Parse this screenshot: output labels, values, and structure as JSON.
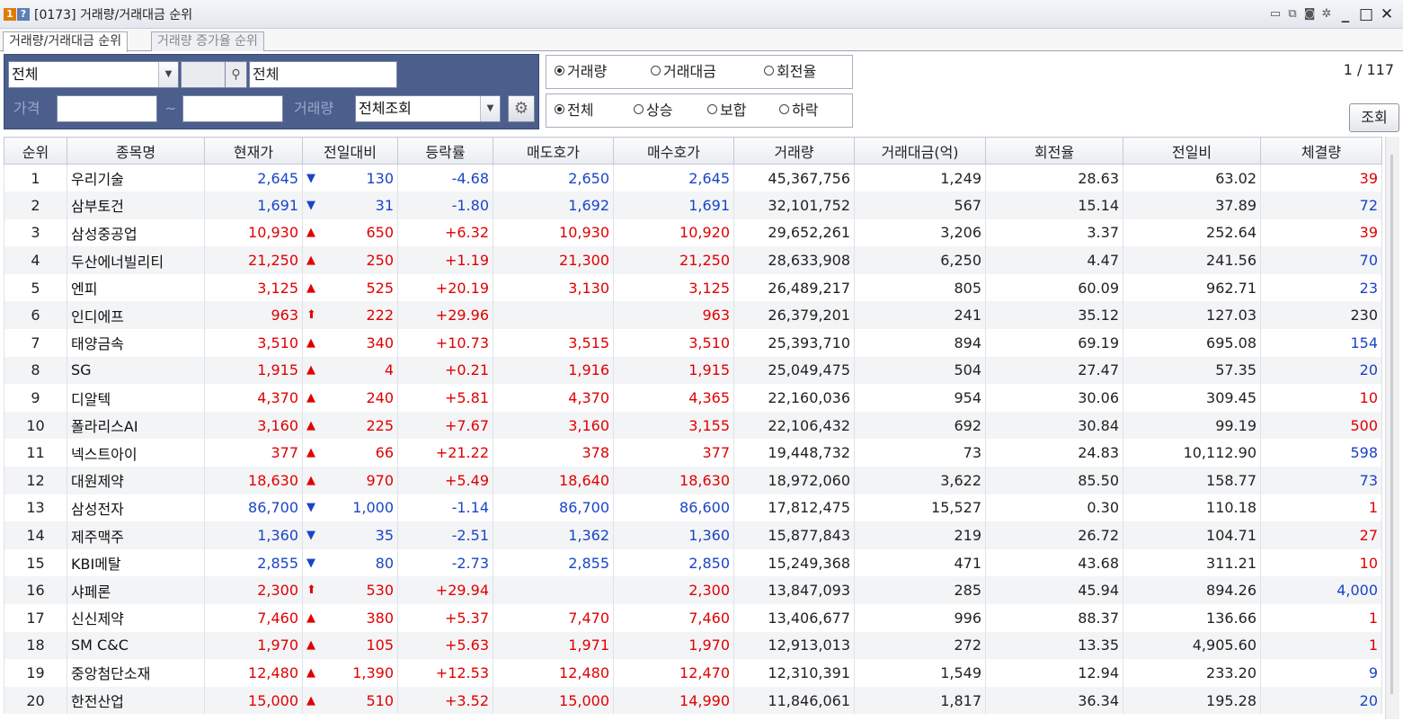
{
  "window": {
    "badge1": "1",
    "badge2": "?",
    "title": "[0173] 거래량/거래대금 순위",
    "minimize": "_",
    "maximize": "□",
    "close": "✕"
  },
  "tabs": [
    {
      "label": "거래량/거래대금 순위",
      "active": true
    },
    {
      "label": "거래량 증가율 순위",
      "active": false
    }
  ],
  "filters": {
    "market_select": "전체",
    "stock_name": "전체",
    "price_label": "가격",
    "range_sep": "~",
    "volume_label": "거래량",
    "volume_select": "전체조회"
  },
  "sort_options": {
    "items": [
      {
        "label": "거래량",
        "selected": true
      },
      {
        "label": "거래대금",
        "selected": false
      },
      {
        "label": "회전율",
        "selected": false
      }
    ]
  },
  "direction_options": {
    "items": [
      {
        "label": "전체",
        "selected": true
      },
      {
        "label": "상승",
        "selected": false
      },
      {
        "label": "보합",
        "selected": false
      },
      {
        "label": "하락",
        "selected": false
      }
    ]
  },
  "pager": "1 / 117",
  "query_button": "조회",
  "colors": {
    "up": "#e10000",
    "down": "#1a44c8",
    "panel": "#4c5e8c"
  },
  "table": {
    "headers": [
      "순위",
      "종목명",
      "현재가",
      "전일대비",
      "등락률",
      "매도호가",
      "매수호가",
      "거래량",
      "거래대금(억)",
      "회전율",
      "전일비",
      "체결량"
    ],
    "rows": [
      {
        "rank": "1",
        "name": "우리기술",
        "price": "2,645",
        "sym": "▼",
        "change": "130",
        "rate": "-4.68",
        "ask": "2,650",
        "bid": "2,645",
        "volume": "45,367,756",
        "amount": "1,249",
        "turnover": "28.63",
        "prevratio": "63.02",
        "exec": "39",
        "dir": "dn",
        "exec_dir": "up"
      },
      {
        "rank": "2",
        "name": "삼부토건",
        "price": "1,691",
        "sym": "▼",
        "change": "31",
        "rate": "-1.80",
        "ask": "1,692",
        "bid": "1,691",
        "volume": "32,101,752",
        "amount": "567",
        "turnover": "15.14",
        "prevratio": "37.89",
        "exec": "72",
        "dir": "dn",
        "exec_dir": "dn"
      },
      {
        "rank": "3",
        "name": "삼성중공업",
        "price": "10,930",
        "sym": "▲",
        "change": "650",
        "rate": "+6.32",
        "ask": "10,930",
        "bid": "10,920",
        "volume": "29,652,261",
        "amount": "3,206",
        "turnover": "3.37",
        "prevratio": "252.64",
        "exec": "39",
        "dir": "up",
        "exec_dir": "up"
      },
      {
        "rank": "4",
        "name": "두산에너빌리티",
        "price": "21,250",
        "sym": "▲",
        "change": "250",
        "rate": "+1.19",
        "ask": "21,300",
        "bid": "21,250",
        "volume": "28,633,908",
        "amount": "6,250",
        "turnover": "4.47",
        "prevratio": "241.56",
        "exec": "70",
        "dir": "up",
        "exec_dir": "dn"
      },
      {
        "rank": "5",
        "name": "엔피",
        "price": "3,125",
        "sym": "▲",
        "change": "525",
        "rate": "+20.19",
        "ask": "3,130",
        "bid": "3,125",
        "volume": "26,489,217",
        "amount": "805",
        "turnover": "60.09",
        "prevratio": "962.71",
        "exec": "23",
        "dir": "up",
        "exec_dir": "dn"
      },
      {
        "rank": "6",
        "name": "인디에프",
        "price": "963",
        "sym": "⬆",
        "change": "222",
        "rate": "+29.96",
        "ask": "",
        "bid": "963",
        "volume": "26,379,201",
        "amount": "241",
        "turnover": "35.12",
        "prevratio": "127.03",
        "exec": "230",
        "dir": "up",
        "exec_dir": "k"
      },
      {
        "rank": "7",
        "name": "태양금속",
        "price": "3,510",
        "sym": "▲",
        "change": "340",
        "rate": "+10.73",
        "ask": "3,515",
        "bid": "3,510",
        "volume": "25,393,710",
        "amount": "894",
        "turnover": "69.19",
        "prevratio": "695.08",
        "exec": "154",
        "dir": "up",
        "exec_dir": "dn"
      },
      {
        "rank": "8",
        "name": "SG",
        "price": "1,915",
        "sym": "▲",
        "change": "4",
        "rate": "+0.21",
        "ask": "1,916",
        "bid": "1,915",
        "volume": "25,049,475",
        "amount": "504",
        "turnover": "27.47",
        "prevratio": "57.35",
        "exec": "20",
        "dir": "up",
        "exec_dir": "dn"
      },
      {
        "rank": "9",
        "name": "디알텍",
        "price": "4,370",
        "sym": "▲",
        "change": "240",
        "rate": "+5.81",
        "ask": "4,370",
        "bid": "4,365",
        "volume": "22,160,036",
        "amount": "954",
        "turnover": "30.06",
        "prevratio": "309.45",
        "exec": "10",
        "dir": "up",
        "exec_dir": "up"
      },
      {
        "rank": "10",
        "name": "폴라리스AI",
        "price": "3,160",
        "sym": "▲",
        "change": "225",
        "rate": "+7.67",
        "ask": "3,160",
        "bid": "3,155",
        "volume": "22,106,432",
        "amount": "692",
        "turnover": "30.84",
        "prevratio": "99.19",
        "exec": "500",
        "dir": "up",
        "exec_dir": "up"
      },
      {
        "rank": "11",
        "name": "넥스트아이",
        "price": "377",
        "sym": "▲",
        "change": "66",
        "rate": "+21.22",
        "ask": "378",
        "bid": "377",
        "volume": "19,448,732",
        "amount": "73",
        "turnover": "24.83",
        "prevratio": "10,112.90",
        "exec": "598",
        "dir": "up",
        "exec_dir": "dn"
      },
      {
        "rank": "12",
        "name": "대원제약",
        "price": "18,630",
        "sym": "▲",
        "change": "970",
        "rate": "+5.49",
        "ask": "18,640",
        "bid": "18,630",
        "volume": "18,972,060",
        "amount": "3,622",
        "turnover": "85.50",
        "prevratio": "158.77",
        "exec": "73",
        "dir": "up",
        "exec_dir": "dn"
      },
      {
        "rank": "13",
        "name": "삼성전자",
        "price": "86,700",
        "sym": "▼",
        "change": "1,000",
        "rate": "-1.14",
        "ask": "86,700",
        "bid": "86,600",
        "volume": "17,812,475",
        "amount": "15,527",
        "turnover": "0.30",
        "prevratio": "110.18",
        "exec": "1",
        "dir": "dn",
        "exec_dir": "up"
      },
      {
        "rank": "14",
        "name": "제주맥주",
        "price": "1,360",
        "sym": "▼",
        "change": "35",
        "rate": "-2.51",
        "ask": "1,362",
        "bid": "1,360",
        "volume": "15,877,843",
        "amount": "219",
        "turnover": "26.72",
        "prevratio": "104.71",
        "exec": "27",
        "dir": "dn",
        "exec_dir": "up"
      },
      {
        "rank": "15",
        "name": "KBI메탈",
        "price": "2,855",
        "sym": "▼",
        "change": "80",
        "rate": "-2.73",
        "ask": "2,855",
        "bid": "2,850",
        "volume": "15,249,368",
        "amount": "471",
        "turnover": "43.68",
        "prevratio": "311.21",
        "exec": "10",
        "dir": "dn",
        "exec_dir": "up"
      },
      {
        "rank": "16",
        "name": "샤페론",
        "price": "2,300",
        "sym": "⬆",
        "change": "530",
        "rate": "+29.94",
        "ask": "",
        "bid": "2,300",
        "volume": "13,847,093",
        "amount": "285",
        "turnover": "45.94",
        "prevratio": "894.26",
        "exec": "4,000",
        "dir": "up",
        "exec_dir": "dn"
      },
      {
        "rank": "17",
        "name": "신신제약",
        "price": "7,460",
        "sym": "▲",
        "change": "380",
        "rate": "+5.37",
        "ask": "7,470",
        "bid": "7,460",
        "volume": "13,406,677",
        "amount": "996",
        "turnover": "88.37",
        "prevratio": "136.66",
        "exec": "1",
        "dir": "up",
        "exec_dir": "up"
      },
      {
        "rank": "18",
        "name": "SM C&C",
        "price": "1,970",
        "sym": "▲",
        "change": "105",
        "rate": "+5.63",
        "ask": "1,971",
        "bid": "1,970",
        "volume": "12,913,013",
        "amount": "272",
        "turnover": "13.35",
        "prevratio": "4,905.60",
        "exec": "1",
        "dir": "up",
        "exec_dir": "up"
      },
      {
        "rank": "19",
        "name": "중앙첨단소재",
        "price": "12,480",
        "sym": "▲",
        "change": "1,390",
        "rate": "+12.53",
        "ask": "12,480",
        "bid": "12,470",
        "volume": "12,310,391",
        "amount": "1,549",
        "turnover": "12.94",
        "prevratio": "233.20",
        "exec": "9",
        "dir": "up",
        "exec_dir": "dn"
      },
      {
        "rank": "20",
        "name": "한전산업",
        "price": "15,000",
        "sym": "▲",
        "change": "510",
        "rate": "+3.52",
        "ask": "15,000",
        "bid": "14,990",
        "volume": "11,846,061",
        "amount": "1,817",
        "turnover": "36.34",
        "prevratio": "195.28",
        "exec": "20",
        "dir": "up",
        "exec_dir": "dn"
      }
    ]
  }
}
